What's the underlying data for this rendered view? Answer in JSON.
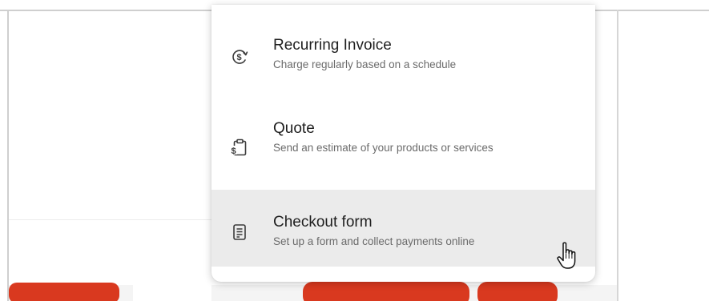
{
  "menu": {
    "items": [
      {
        "title": "Recurring Invoice",
        "description": "Charge regularly based on a schedule",
        "icon": "recurring-dollar-icon"
      },
      {
        "title": "Quote",
        "description": "Send an estimate of your products or services",
        "icon": "quote-clipboard-icon"
      },
      {
        "title": "Checkout form",
        "description": "Set up a form and collect payments online",
        "icon": "checkout-form-icon",
        "hovered": true
      }
    ]
  },
  "colors": {
    "accent_red": "#d9391f",
    "hover_background": "#ebebeb",
    "title_text": "#1f1f1f",
    "description_text": "#6b6b6b"
  },
  "cursor": "hand-pointer-icon"
}
